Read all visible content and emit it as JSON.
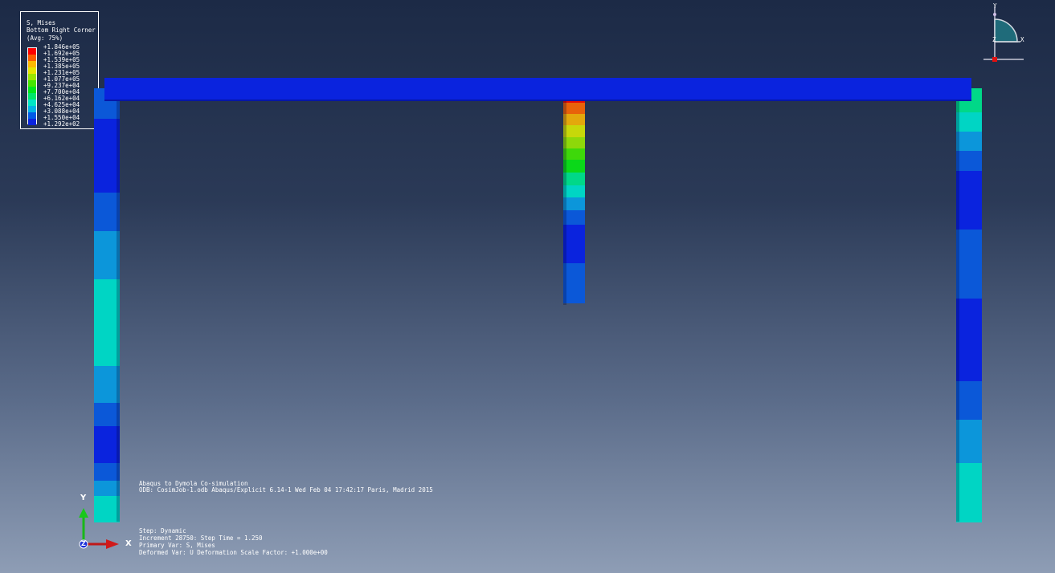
{
  "legend": {
    "title_lines": [
      "S, Mises",
      "Bottom Right Corner",
      "(Avg: 75%)"
    ],
    "levels": [
      {
        "label": "+1.846e+05",
        "color": "#ff0000"
      },
      {
        "label": "+1.692e+05",
        "color": "#ff5b00"
      },
      {
        "label": "+1.539e+05",
        "color": "#ffb900"
      },
      {
        "label": "+1.385e+05",
        "color": "#e6e600"
      },
      {
        "label": "+1.231e+05",
        "color": "#9ae600"
      },
      {
        "label": "+1.077e+05",
        "color": "#46e600"
      },
      {
        "label": "+9.237e+04",
        "color": "#00e61a"
      },
      {
        "label": "+7.700e+04",
        "color": "#00e66a"
      },
      {
        "label": "+6.162e+04",
        "color": "#00e6c6"
      },
      {
        "label": "+4.625e+04",
        "color": "#00b4e6"
      },
      {
        "label": "+3.088e+04",
        "color": "#005ae6"
      },
      {
        "label": "+1.550e+04",
        "color": "#0a23de"
      },
      {
        "label": "+1.292e+02",
        "color": ""
      }
    ]
  },
  "model": {
    "beam_color": "#0a23de",
    "left_column": [
      {
        "color": "#0b58d8",
        "frac": 0.07
      },
      {
        "color": "#0a23de",
        "frac": 0.17
      },
      {
        "color": "#0b58d8",
        "frac": 0.09
      },
      {
        "color": "#0c96da",
        "frac": 0.11
      },
      {
        "color": "#00d5c4",
        "frac": 0.2
      },
      {
        "color": "#0c96da",
        "frac": 0.085
      },
      {
        "color": "#0b58d8",
        "frac": 0.055
      },
      {
        "color": "#0a23de",
        "frac": 0.085
      },
      {
        "color": "#0b58d8",
        "frac": 0.04
      },
      {
        "color": "#0c96da",
        "frac": 0.035
      },
      {
        "color": "#00d5c4",
        "frac": 0.06
      }
    ],
    "center_column": [
      {
        "color": "#e50a05",
        "frac": 0.03
      },
      {
        "color": "#e8620a",
        "frac": 0.055
      },
      {
        "color": "#e3a80c",
        "frac": 0.055
      },
      {
        "color": "#c7d80a",
        "frac": 0.055
      },
      {
        "color": "#8ed80a",
        "frac": 0.055
      },
      {
        "color": "#3ed80a",
        "frac": 0.055
      },
      {
        "color": "#0ad819",
        "frac": 0.06
      },
      {
        "color": "#00d888",
        "frac": 0.06
      },
      {
        "color": "#00d5c4",
        "frac": 0.06
      },
      {
        "color": "#0c96da",
        "frac": 0.06
      },
      {
        "color": "#0b58d8",
        "frac": 0.07
      },
      {
        "color": "#0a23de",
        "frac": 0.185
      },
      {
        "color": "#0b58d8",
        "frac": 0.19
      }
    ],
    "right_column": [
      {
        "color": "#00d888",
        "frac": 0.055
      },
      {
        "color": "#00d5c4",
        "frac": 0.045
      },
      {
        "color": "#0c96da",
        "frac": 0.045
      },
      {
        "color": "#0b58d8",
        "frac": 0.045
      },
      {
        "color": "#0a23de",
        "frac": 0.135
      },
      {
        "color": "#0b58d8",
        "frac": 0.16
      },
      {
        "color": "#0a23de",
        "frac": 0.19
      },
      {
        "color": "#0b58d8",
        "frac": 0.09
      },
      {
        "color": "#0c96da",
        "frac": 0.1
      },
      {
        "color": "#00d5c4",
        "frac": 0.135
      }
    ]
  },
  "info_top": [
    "Abaqus to Dymola Co-simulation",
    "ODB: CosimJob-1.odb    Abaqus/Explicit 6.14-1    Wed Feb 04 17:42:17 Paris, Madrid 2015"
  ],
  "info_bottom": [
    "Step: Dynamic",
    "Increment    28750: Step Time =    1.250",
    "Primary Var: S, Mises",
    "Deformed Var: U   Deformation Scale Factor: +1.000e+00"
  ],
  "triad": {
    "x": "X",
    "y": "Y",
    "z": "Z"
  },
  "viewcube": {
    "x": "X",
    "y": "Y",
    "z": "Z"
  }
}
